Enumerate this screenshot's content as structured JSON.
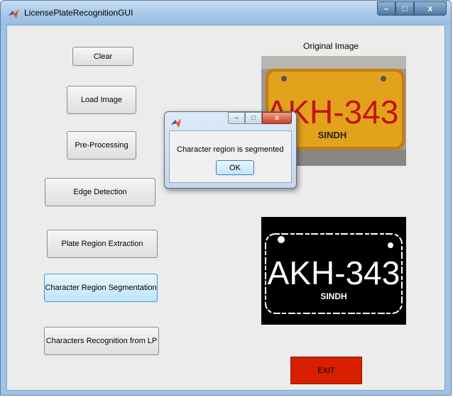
{
  "window": {
    "title": "LicensePlateRecognitionGUI",
    "controls": {
      "minimize": "–",
      "maximize": "□",
      "close": "x"
    }
  },
  "buttons": {
    "clear": "Clear",
    "load_image": "Load Image",
    "pre_processing": "Pre-Processing",
    "edge_detection": "Edge Detection",
    "plate_region_extraction": "Plate Region Extraction",
    "character_region_segmentation": "Character Region Segmentation",
    "characters_recognition": "Characters Recognition from LP",
    "exit": "EXIT"
  },
  "images": {
    "original_label": "Original Image",
    "plate_text": "AKH-343",
    "plate_subtext": "SINDH"
  },
  "dialog": {
    "message": "Character region is segmented",
    "ok_label": "OK",
    "controls": {
      "minimize": "–",
      "maximize": "□",
      "close": "x"
    }
  },
  "colors": {
    "exit_button": "#d71f00",
    "active_button": "#bfe4f8",
    "plate_yellow": "#e3a21c"
  },
  "icons": {
    "app": "matlab-logo-icon"
  }
}
